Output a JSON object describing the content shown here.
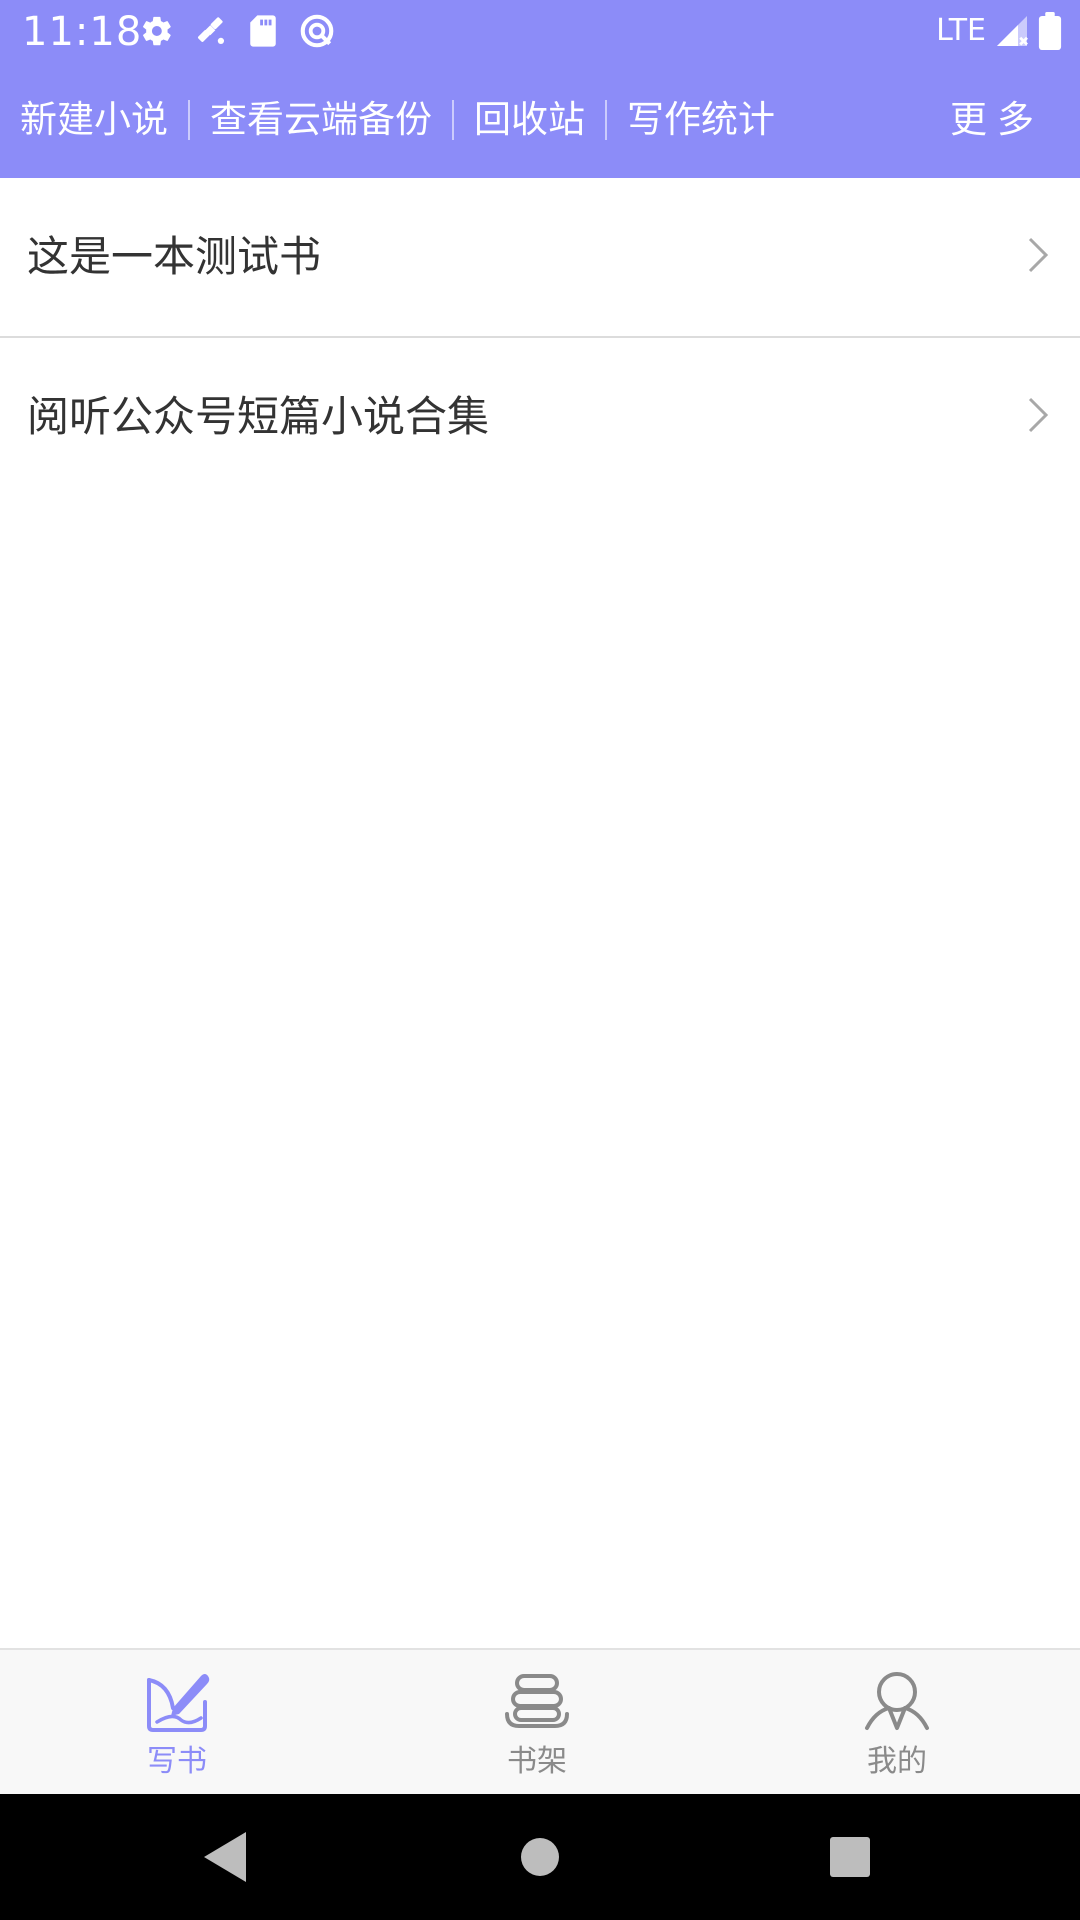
{
  "status_bar": {
    "time": "11:18",
    "network": "LTE",
    "icons": [
      "settings-icon",
      "satellite-icon",
      "sd-card-icon",
      "vpn-icon",
      "signal-icon",
      "battery-icon"
    ]
  },
  "toolbar": {
    "items": [
      {
        "label": "新建小说"
      },
      {
        "label": "查看云端备份"
      },
      {
        "label": "回收站"
      },
      {
        "label": "写作统计"
      }
    ],
    "more_label": "更多"
  },
  "books": [
    {
      "title": "这是一本测试书"
    },
    {
      "title": "阅听公众号短篇小说合集"
    }
  ],
  "bottom_nav": {
    "items": [
      {
        "label": "写书",
        "icon": "write-icon",
        "active": true
      },
      {
        "label": "书架",
        "icon": "bookshelf-icon",
        "active": false
      },
      {
        "label": "我的",
        "icon": "profile-icon",
        "active": false
      }
    ]
  },
  "colors": {
    "accent": "#8c8cf8",
    "text_primary": "#333333",
    "text_inactive": "#8a8a8a",
    "divider": "#dcdcdc"
  }
}
